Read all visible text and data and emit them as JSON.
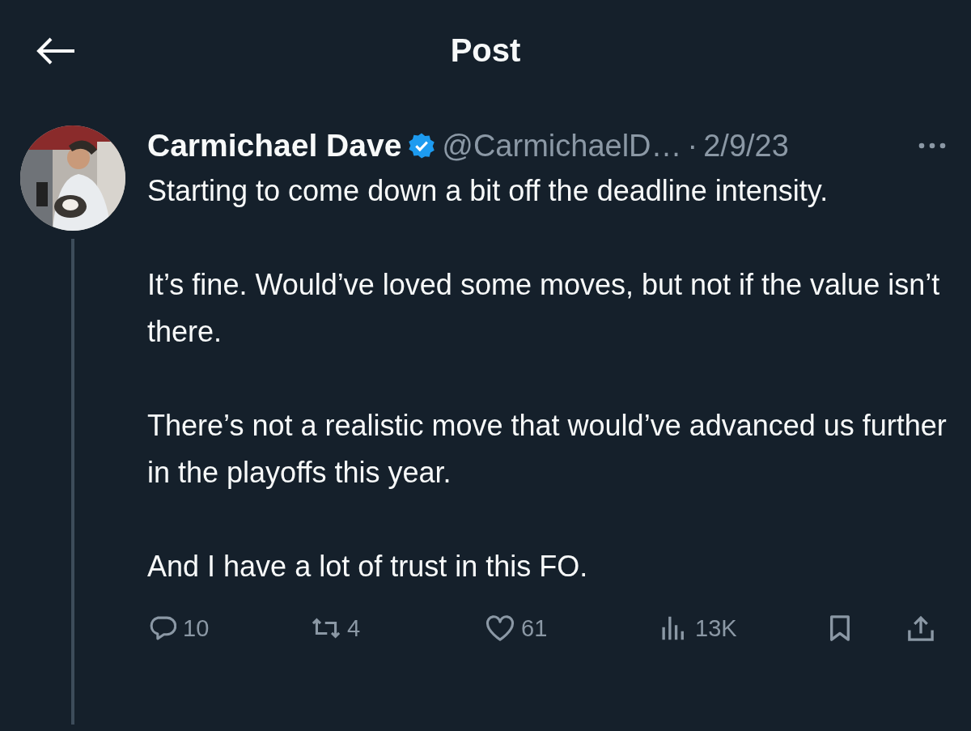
{
  "header": {
    "title": "Post"
  },
  "post": {
    "author": {
      "name": "Carmichael Dave",
      "verified": true,
      "handle": "@CarmichaelD…",
      "separator": "·",
      "date": "2/9/23"
    },
    "thread_line": true,
    "paragraphs": [
      "Starting to come down a bit off the deadline intensity.",
      "It’s fine. Would’ve loved some moves, but not if the value isn’t there.",
      "There’s not a realistic move that would’ve advanced us further in the playoffs this year.",
      "And I have a lot of trust in this FO."
    ],
    "actions": [
      {
        "kind": "reply",
        "count": "10"
      },
      {
        "kind": "repost",
        "count": "4"
      },
      {
        "kind": "like",
        "count": "61"
      },
      {
        "kind": "views",
        "count": "13K"
      },
      {
        "kind": "bookmark"
      },
      {
        "kind": "share"
      }
    ]
  }
}
